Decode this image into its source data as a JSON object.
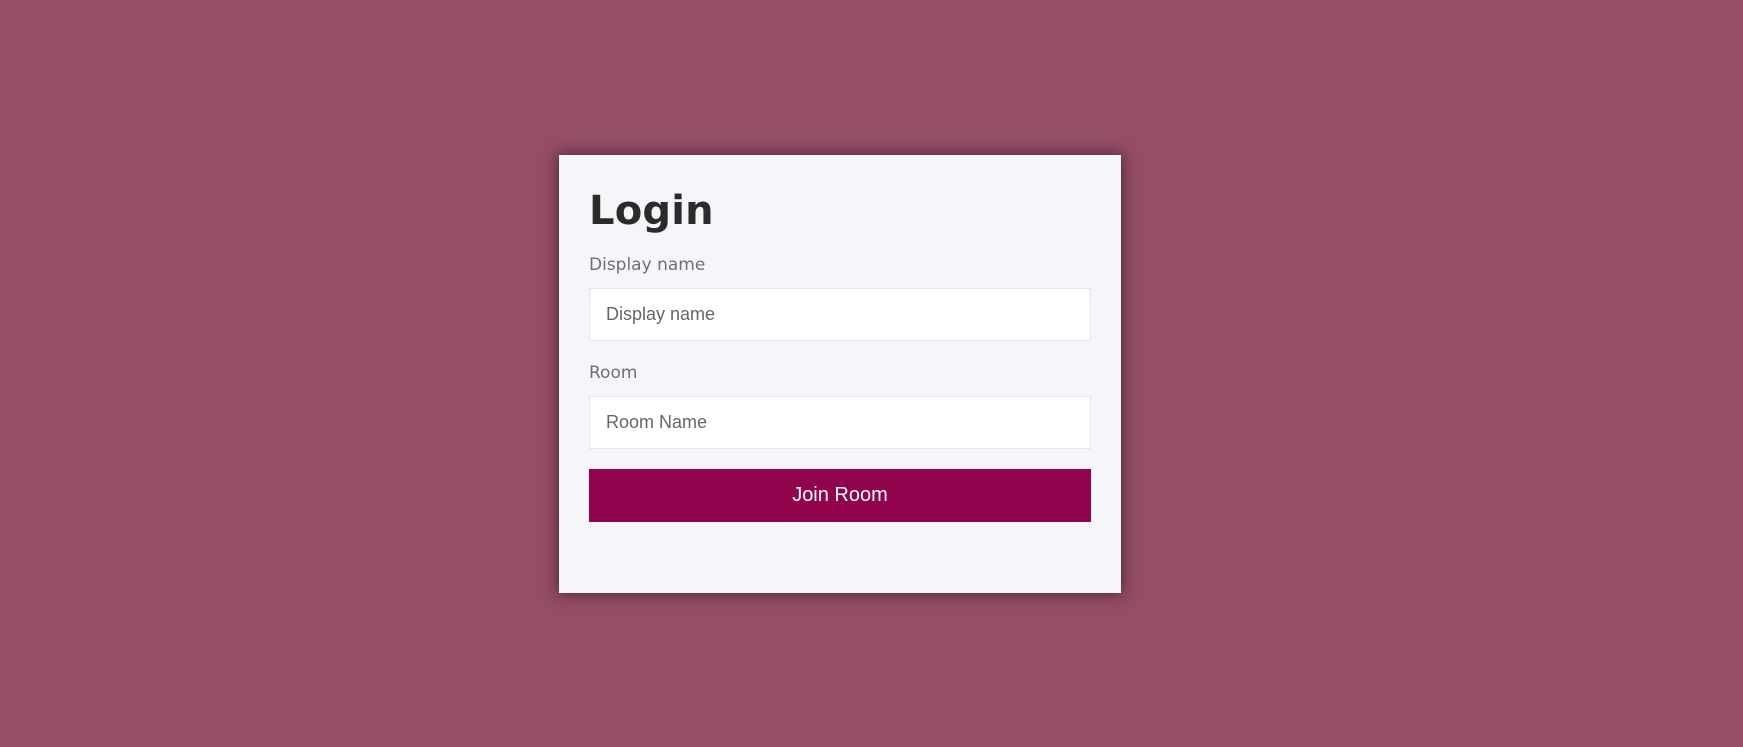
{
  "login": {
    "title": "Login",
    "display_name_label": "Display name",
    "display_name_placeholder": "Display name",
    "display_name_value": "",
    "room_label": "Room",
    "room_placeholder": "Room Name",
    "room_value": "",
    "join_label": "Join Room"
  },
  "colors": {
    "background": "#944f67",
    "card": "#f6f6fa",
    "button": "#92034e",
    "title_text": "#2b2b2b",
    "label_text": "#6f6f6f"
  }
}
